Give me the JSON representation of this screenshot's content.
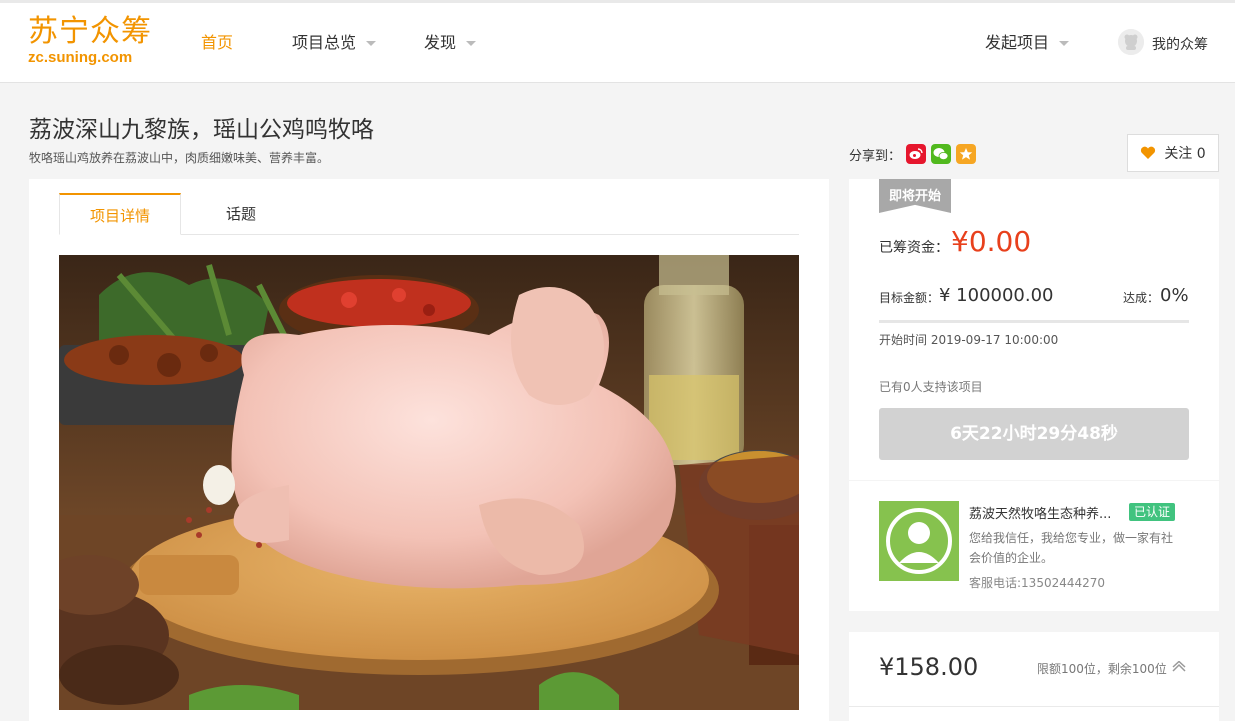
{
  "header": {
    "logo_cn": "苏宁众筹",
    "logo_url": "zc.suning.com",
    "nav": [
      {
        "label": "首页"
      },
      {
        "label": "项目总览"
      },
      {
        "label": "发现"
      }
    ],
    "launch_label": "发起项目",
    "my_label": "我的众筹"
  },
  "project": {
    "title": "荔波深山九黎族，瑶山公鸡鸣牧咯",
    "subtitle": "牧咯瑶山鸡放养在荔波山中，肉质细嫩味美、营养丰富。",
    "share_label": "分享到：",
    "follow_label": "关注 0"
  },
  "tabs": [
    {
      "label": "项目详情"
    },
    {
      "label": "话题"
    }
  ],
  "funding": {
    "status_badge": "即将开始",
    "raised_label": "已筹资金：",
    "raised_value": "¥0.00",
    "target_label": "目标金额：",
    "target_value": "¥ 100000.00",
    "rate_label": "达成：",
    "rate_value": "0%",
    "progress_fraction": 0,
    "start_time": "开始时间 2019-09-17 10:00:00",
    "supporters": "已有0人支持该项目",
    "countdown": "6天22小时29分48秒"
  },
  "company": {
    "name": "荔波天然牧咯生态种养...",
    "verified": "已认证",
    "desc": "您给我信任，我给您专业，做一家有社会价值的企业。",
    "phone": "客服电话:13502444270"
  },
  "reward": {
    "price": "¥158.00",
    "limit": "限额100位，剩余100位"
  },
  "colors": {
    "accent": "#f29400",
    "raised": "#e8401c",
    "verified": "#41c37f"
  }
}
